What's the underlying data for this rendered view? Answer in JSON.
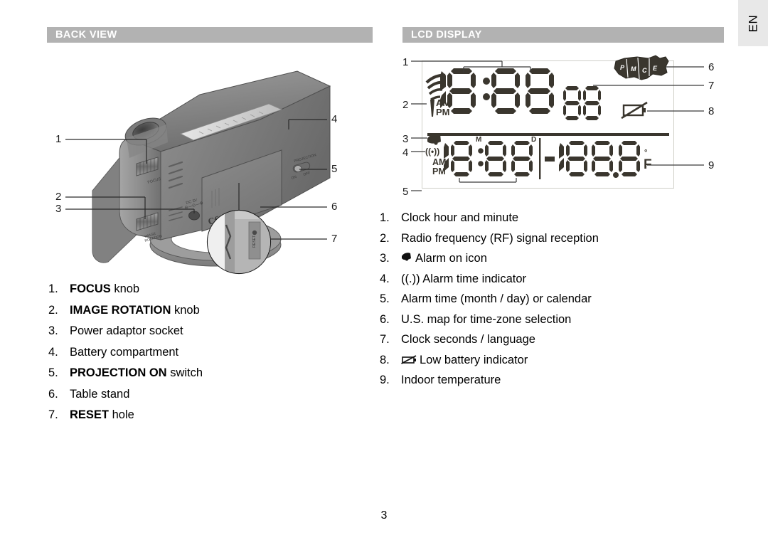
{
  "language_tab": {
    "label": "EN"
  },
  "page": {
    "number": "3"
  },
  "sections": {
    "back_view": {
      "title": "BACK VIEW"
    },
    "lcd_display": {
      "title": "LCD DISPLAY"
    }
  },
  "back_view_list": [
    {
      "num": "1.",
      "bold": "FOCUS",
      "rest": " knob"
    },
    {
      "num": "2.",
      "bold": "IMAGE ROTATION",
      "rest": " knob"
    },
    {
      "num": "3.",
      "bold": "",
      "rest": "Power adaptor socket"
    },
    {
      "num": "4.",
      "bold": "",
      "rest": "Battery compartment"
    },
    {
      "num": "5.",
      "bold": "PROJECTION ON",
      "rest": " switch"
    },
    {
      "num": "6.",
      "bold": "",
      "rest": "Table stand"
    },
    {
      "num": "7.",
      "bold": "RESET",
      "rest": " hole"
    }
  ],
  "lcd_display_list": [
    {
      "num": "1.",
      "icon": "",
      "text": "Clock hour and minute"
    },
    {
      "num": "2.",
      "icon": "",
      "text": "Radio frequency (RF) signal reception"
    },
    {
      "num": "3.",
      "icon": "alarm-bell-icon",
      "text": "Alarm on icon"
    },
    {
      "num": "4.",
      "icon": "",
      "text": "((.)) Alarm time indicator"
    },
    {
      "num": "5.",
      "icon": "",
      "text": "Alarm time (month / day) or calendar"
    },
    {
      "num": "6.",
      "icon": "",
      "text": "U.S. map for time-zone selection"
    },
    {
      "num": "7.",
      "icon": "",
      "text": "Clock seconds / language"
    },
    {
      "num": "8.",
      "icon": "low-battery-icon",
      "text": "Low battery indicator"
    },
    {
      "num": "9.",
      "icon": "",
      "text": "Indoor temperature"
    }
  ],
  "back_view_callouts": [
    "1",
    "2",
    "3",
    "4",
    "5",
    "6",
    "7"
  ],
  "lcd_callouts": [
    "1",
    "2",
    "3",
    "4",
    "5",
    "6",
    "7",
    "8",
    "9"
  ],
  "lcd_screen": {
    "clock_time": "18:88",
    "seconds": "88",
    "am_top": "AM",
    "pm_top": "PM",
    "am_bottom": "AM",
    "pm_bottom": "PM",
    "month_label": "M",
    "day_label": "D",
    "alarm_date": "18:88",
    "temperature": "-188.8",
    "temp_degree": "°",
    "temp_unit": "F",
    "timezone_labels": [
      "P",
      "M",
      "C",
      "E"
    ],
    "rf_icon": "rf-signal-icon",
    "alarm_icon": "alarm-bell-icon",
    "alarm_time_icon": "((•))",
    "low_battery_icon": "low-battery-icon",
    "map_icon": "us-map-icon"
  },
  "colors": {
    "header_bar": "#b2b2b2",
    "header_text": "#ffffff",
    "lcd_segment": "#3a362e",
    "lcd_frame": "#cfcfc8",
    "lang_tab_bg": "#e8e8e8",
    "device_body": "#8a8a8a"
  }
}
